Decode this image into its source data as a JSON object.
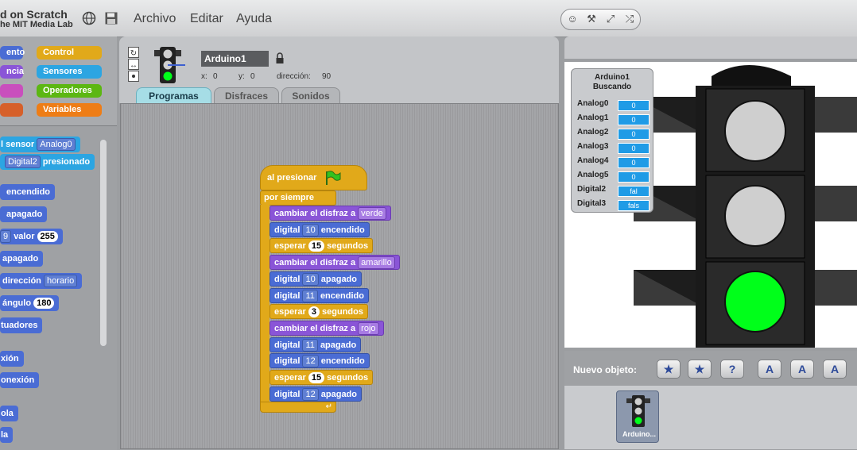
{
  "app": {
    "logo_line1": "d on Scratch",
    "logo_line2": "he MIT Media Lab"
  },
  "menu": {
    "file": "Archivo",
    "edit": "Editar",
    "help": "Ayuda"
  },
  "categories": [
    {
      "label": "ento",
      "color": "#4a6cd4"
    },
    {
      "label": "ncia",
      "color": "#8a55d7"
    },
    {
      "label": "",
      "color": "#c94fbd"
    },
    {
      "label": "",
      "color": "#d6602a"
    },
    {
      "label": "Control",
      "color": "#e1a91a"
    },
    {
      "label": "Sensores",
      "color": "#2ca5e2"
    },
    {
      "label": "Operadores",
      "color": "#5cb712"
    },
    {
      "label": "Variables",
      "color": "#ee7d16"
    }
  ],
  "palette": {
    "sensor_label": "l sensor",
    "sensor_dd": "Analog0",
    "digital_dd": "Digital2",
    "pressed": "presionado",
    "on": "encendido",
    "off": "apagado",
    "value_prefix": "9",
    "value": "valor",
    "value_num": "255",
    "off2": "apagado",
    "direction": "dirección",
    "direction_dd": "horario",
    "angle": "ángulo",
    "angle_num": "180",
    "actuators": "tuadores",
    "conn1": "xión",
    "conn2": "onexión",
    "b1": "ola",
    "b2": "la"
  },
  "sprite": {
    "name": "Arduino1",
    "x_label": "x:",
    "x_val": "0",
    "y_label": "y:",
    "y_val": "0",
    "dir_label": "dirección:",
    "dir_val": "90"
  },
  "tabs": [
    "Programas",
    "Disfraces",
    "Sonidos"
  ],
  "script": {
    "hat": "al presionar",
    "forever": "por siempre",
    "costume_label": "cambiar el disfraz a",
    "digital_label": "digital",
    "wait_label": "esperar",
    "seconds_label": "segundos",
    "on": "encendido",
    "off": "apagado",
    "rows": [
      {
        "kind": "costume",
        "value": "verde"
      },
      {
        "kind": "digital",
        "pin": "10",
        "state": "encendido"
      },
      {
        "kind": "wait",
        "value": "15"
      },
      {
        "kind": "costume",
        "value": "amarillo"
      },
      {
        "kind": "digital",
        "pin": "10",
        "state": "apagado"
      },
      {
        "kind": "digital",
        "pin": "11",
        "state": "encendido"
      },
      {
        "kind": "wait",
        "value": "3"
      },
      {
        "kind": "costume",
        "value": "rojo"
      },
      {
        "kind": "digital",
        "pin": "11",
        "state": "apagado"
      },
      {
        "kind": "digital",
        "pin": "12",
        "state": "encendido"
      },
      {
        "kind": "wait",
        "value": "15"
      },
      {
        "kind": "digital",
        "pin": "12",
        "state": "apagado"
      }
    ]
  },
  "sensor_board": {
    "title1": "Arduino1",
    "title2": "Buscando",
    "rows": [
      {
        "name": "Analog0",
        "value": "0"
      },
      {
        "name": "Analog1",
        "value": "0"
      },
      {
        "name": "Analog2",
        "value": "0"
      },
      {
        "name": "Analog3",
        "value": "0"
      },
      {
        "name": "Analog4",
        "value": "0"
      },
      {
        "name": "Analog5",
        "value": "0"
      },
      {
        "name": "Digital2",
        "value": "fal"
      },
      {
        "name": "Digital3",
        "value": "fals"
      }
    ]
  },
  "new_sprite_label": "Nuevo objeto:",
  "sprite_thumb_label": "Arduino...",
  "colors": {
    "green_light": "#00ff1a",
    "off_light": "#cfcfcf"
  }
}
